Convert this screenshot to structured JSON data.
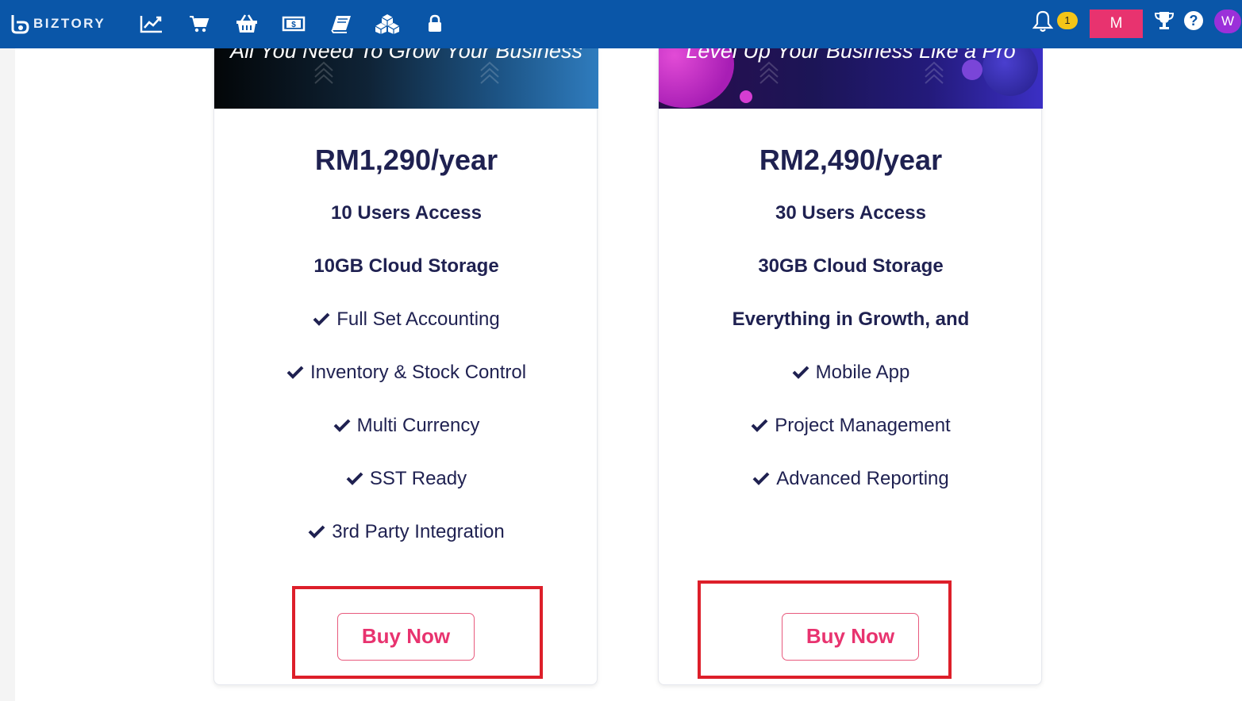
{
  "navbar": {
    "brand": "BIZTORY",
    "nav_icons": [
      "chart-line-icon",
      "cart-icon",
      "basket-icon",
      "money-bill-icon",
      "book-icon",
      "cubes-icon",
      "lock-icon"
    ],
    "notification_count": "1",
    "user_button_label": "M",
    "avatar_initial": "W",
    "help_label": "?",
    "colors": {
      "bar": "#0a56a8",
      "user_button": "#e8336f",
      "badge": "#f5c518",
      "avatar": "#9b30d9"
    }
  },
  "plans": [
    {
      "tagline": "All You Need To Grow Your Business",
      "price": "RM1,290/year",
      "features": [
        {
          "text": "10 Users Access",
          "check": false
        },
        {
          "text": "10GB Cloud Storage",
          "check": false
        },
        {
          "text": "Full Set Accounting",
          "check": true
        },
        {
          "text": "Inventory & Stock Control",
          "check": true
        },
        {
          "text": "Multi Currency",
          "check": true
        },
        {
          "text": "SST Ready",
          "check": true
        },
        {
          "text": "3rd Party Integration",
          "check": true
        }
      ],
      "button_label": "Buy Now"
    },
    {
      "tagline": "Level Up Your Business Like a Pro",
      "price": "RM2,490/year",
      "features": [
        {
          "text": "30 Users Access",
          "check": false
        },
        {
          "text": "30GB Cloud Storage",
          "check": false
        },
        {
          "text": "Everything in Growth, and",
          "check": false
        },
        {
          "text": "Mobile App",
          "check": true
        },
        {
          "text": "Project Management",
          "check": true
        },
        {
          "text": "Advanced Reporting",
          "check": true
        }
      ],
      "button_label": "Buy Now"
    }
  ],
  "colors": {
    "text": "#1f2151",
    "accent": "#e8336f",
    "highlight": "#dd1f2a"
  }
}
